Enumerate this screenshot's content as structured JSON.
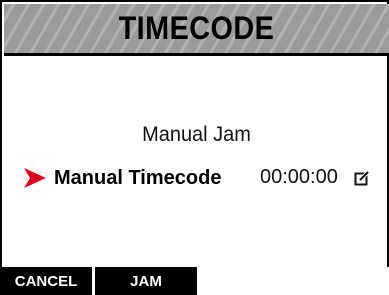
{
  "header": {
    "title": "TIMECODE"
  },
  "menu": {
    "mode_label": "Manual Jam",
    "selected_item": {
      "label": "Manual Timecode",
      "value": "00:00:00"
    }
  },
  "softkeys": {
    "cancel_label": "CANCEL",
    "jam_label": "JAM"
  },
  "icons": {
    "selection": "red-arrow-pointer",
    "edit": "edit-pencil-box"
  },
  "colors": {
    "accent_arrow": "#e3001b",
    "title_bar": "#9b9b9b",
    "softkey_bg": "#000000",
    "softkey_text": "#ffffff"
  }
}
